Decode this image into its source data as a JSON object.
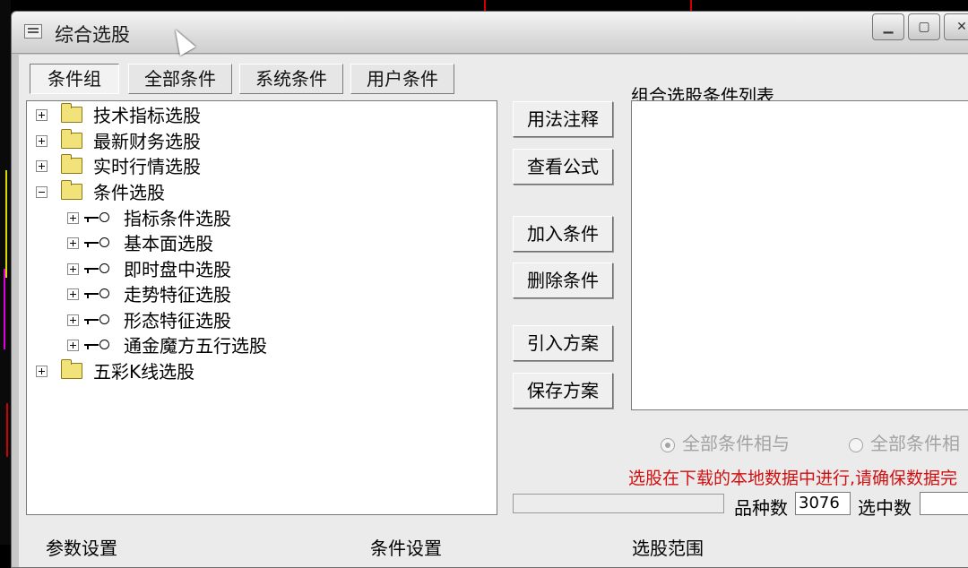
{
  "window": {
    "title": "综合选股"
  },
  "tabs": [
    {
      "label": "条件组"
    },
    {
      "label": "全部条件"
    },
    {
      "label": "系统条件"
    },
    {
      "label": "用户条件"
    }
  ],
  "tree": {
    "groups": [
      {
        "label": "技术指标选股"
      },
      {
        "label": "最新财务选股"
      },
      {
        "label": "实时行情选股"
      },
      {
        "label": "条件选股"
      },
      {
        "label": "五彩K线选股"
      }
    ],
    "children": [
      {
        "label": "指标条件选股"
      },
      {
        "label": "基本面选股"
      },
      {
        "label": "即时盘中选股"
      },
      {
        "label": "走势特征选股"
      },
      {
        "label": "形态特征选股"
      },
      {
        "label": "通金魔方五行选股"
      }
    ]
  },
  "buttons": {
    "usage": "用法注释",
    "formula": "查看公式",
    "add": "加入条件",
    "delete": "删除条件",
    "import": "引入方案",
    "save": "保存方案"
  },
  "list": {
    "title": "组合选股条件列表"
  },
  "radios": {
    "and": "全部条件相与",
    "or": "全部条件相"
  },
  "warning": "选股在下载的本地数据中进行,请确保数据完",
  "stats": {
    "count_label": "品种数",
    "count_value": "3076",
    "selected_label": "选中数"
  },
  "sections": {
    "params": "参数设置",
    "conditions": "条件设置",
    "range": "选股范围"
  }
}
